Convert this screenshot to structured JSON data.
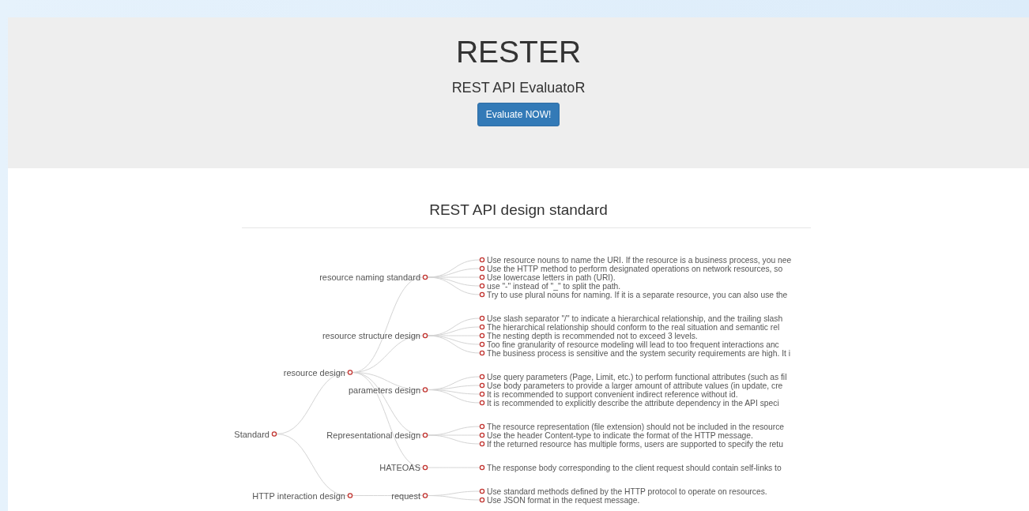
{
  "header": {
    "title": "RESTER",
    "subtitle": "REST API EvaluatoR",
    "button": "Evaluate NOW!"
  },
  "section": {
    "title": "REST API design standard"
  },
  "tree": {
    "label": "Standard",
    "children": [
      {
        "label": "resource design",
        "children": [
          {
            "label": "resource naming standard",
            "children": [
              {
                "label": "Use resource nouns to name the URI. If the resource is a business process, you nee"
              },
              {
                "label": "Use the HTTP method to perform designated operations on network resources, so"
              },
              {
                "label": "Use lowercase letters in path (URI)."
              },
              {
                "label": "use \"-\" instead of \"_\" to split the path."
              },
              {
                "label": "Try to use plural nouns for naming. If it is a separate resource, you can also use the"
              }
            ]
          },
          {
            "label": "resource structure design",
            "children": [
              {
                "label": "Use slash separator \"/\" to indicate a hierarchical relationship, and the trailing slash"
              },
              {
                "label": "The hierarchical relationship should conform to the real situation and semantic rel"
              },
              {
                "label": "The nesting depth is recommended not to exceed 3 levels."
              },
              {
                "label": "Too fine granularity of resource modeling will lead to too frequent interactions anc"
              },
              {
                "label": "The business process is sensitive and the system security requirements are high. It i"
              }
            ]
          },
          {
            "label": "parameters design",
            "children": [
              {
                "label": "Use query parameters (Page, Limit, etc.) to perform functional attributes (such as fil"
              },
              {
                "label": "Use body parameters to provide a larger amount of attribute values (in update, cre"
              },
              {
                "label": "It is recommended to support convenient indirect reference without id."
              },
              {
                "label": "It is recommended to explicitly describe the attribute dependency in the API speci"
              }
            ]
          },
          {
            "label": "Representational design",
            "children": [
              {
                "label": "The resource representation (file extension) should not be included in the resource"
              },
              {
                "label": "Use the header Content-type to indicate the format of the HTTP message."
              },
              {
                "label": "If the returned resource has multiple forms, users are supported to specify the retu"
              }
            ]
          },
          {
            "label": "HATEOAS",
            "children": [
              {
                "label": "The response body corresponding to the client request should contain self-links to"
              }
            ]
          }
        ]
      },
      {
        "label": "HTTP interaction design",
        "children": [
          {
            "label": "request",
            "children": [
              {
                "label": "Use standard methods defined by the HTTP protocol to operate on resources."
              },
              {
                "label": "Use JSON format in the request message."
              }
            ]
          }
        ]
      }
    ]
  }
}
